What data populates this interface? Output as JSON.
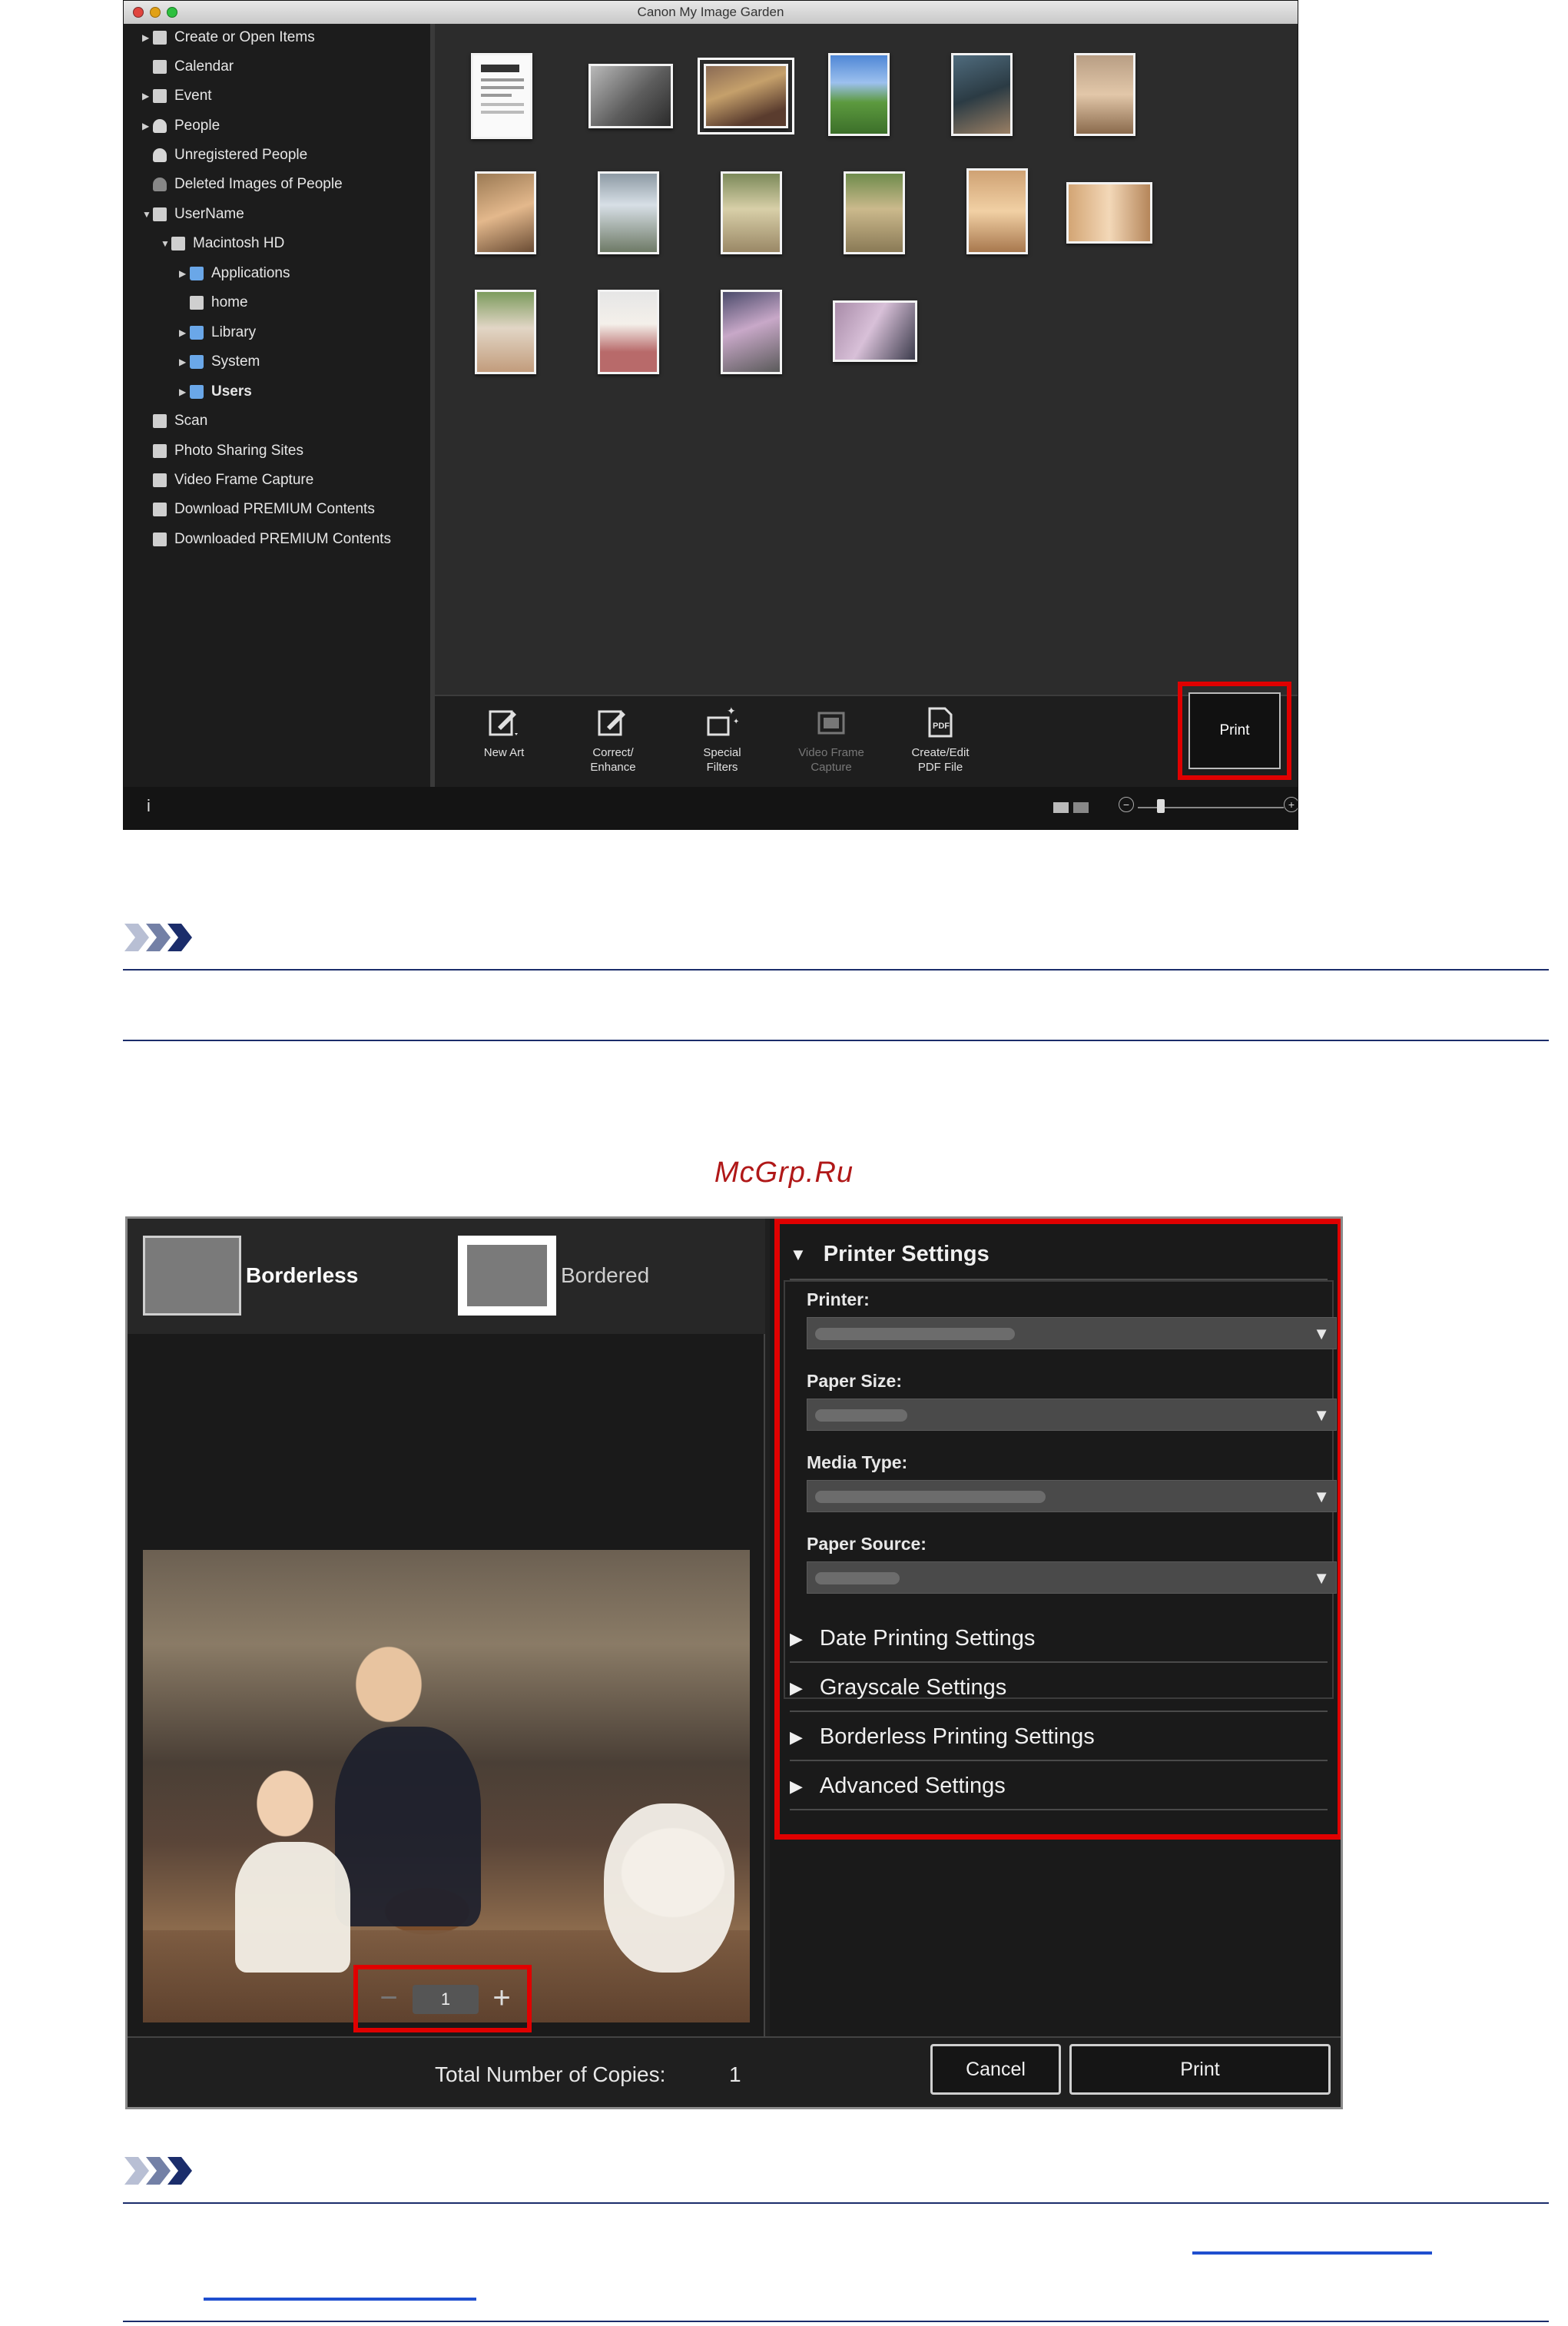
{
  "window1": {
    "title": "Canon My Image Garden",
    "sidebar": {
      "items": [
        {
          "label": "Create or Open Items",
          "icon": "create-items-icon"
        },
        {
          "label": "Calendar",
          "icon": "calendar-icon"
        },
        {
          "label": "Event",
          "icon": "event-icon"
        },
        {
          "label": "People",
          "icon": "person-icon"
        },
        {
          "label": "Unregistered People",
          "icon": "unregistered-person-icon"
        },
        {
          "label": "Deleted Images of People",
          "icon": "deleted-person-icon"
        },
        {
          "label": "UserName",
          "icon": "computer-icon"
        },
        {
          "label": "Macintosh HD",
          "icon": "hard-drive-icon"
        },
        {
          "label": "Applications",
          "icon": "folder-icon"
        },
        {
          "label": "home",
          "icon": "home-icon"
        },
        {
          "label": "Library",
          "icon": "folder-icon"
        },
        {
          "label": "System",
          "icon": "folder-icon"
        },
        {
          "label": "Users",
          "icon": "folder-icon"
        },
        {
          "label": "Scan",
          "icon": "scan-icon"
        },
        {
          "label": "Photo Sharing Sites",
          "icon": "photo-sharing-icon"
        },
        {
          "label": "Video Frame Capture",
          "icon": "video-frame-icon"
        },
        {
          "label": "Download PREMIUM Contents",
          "icon": "download-icon"
        },
        {
          "label": "Downloaded PREMIUM Contents",
          "icon": "downloaded-folder-icon"
        }
      ]
    },
    "toolbar": {
      "new_art": "New Art",
      "correct_enhance_1": "Correct/",
      "correct_enhance_2": "Enhance",
      "special_filters_1": "Special",
      "special_filters_2": "Filters",
      "video_frame_1": "Video Frame",
      "video_frame_2": "Capture",
      "create_pdf_1": "Create/Edit",
      "create_pdf_2": "PDF File",
      "print": "Print"
    },
    "statusbar": {
      "info": "i",
      "zoom_minus": "−",
      "zoom_plus": "+"
    }
  },
  "watermark": "McGrp.Ru",
  "window2": {
    "layout": {
      "borderless": "Borderless",
      "bordered": "Bordered"
    },
    "copies_value": "1",
    "stepper_minus": "−",
    "stepper_plus": "+",
    "printer_settings": {
      "title": "Printer Settings",
      "printer_label": "Printer:",
      "paper_size_label": "Paper Size:",
      "media_type_label": "Media Type:",
      "paper_source_label": "Paper Source:"
    },
    "collapsed_sections": [
      "Date Printing Settings",
      "Grayscale Settings",
      "Borderless Printing Settings",
      "Advanced Settings"
    ],
    "footer": {
      "total_label": "Total Number of Copies:",
      "total_value": "1",
      "cancel": "Cancel",
      "print": "Print"
    }
  },
  "colors": {
    "highlight": "#e00000",
    "rule": "#1b2d6b",
    "link": "#1f4fcf",
    "watermark": "#b01818"
  }
}
